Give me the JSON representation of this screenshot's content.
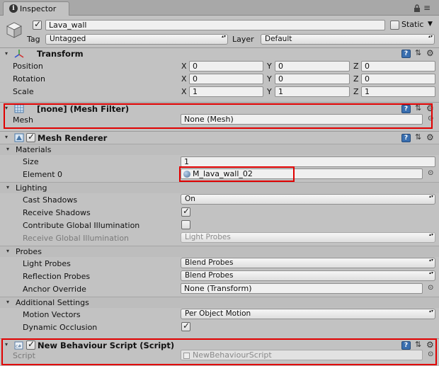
{
  "tab": {
    "label": "Inspector"
  },
  "header": {
    "name": "Lava_wall",
    "static_label": "Static",
    "tag_label": "Tag",
    "tag_value": "Untagged",
    "layer_label": "Layer",
    "layer_value": "Default"
  },
  "transform": {
    "title": "Transform",
    "rows": [
      {
        "label": "Position",
        "x": "0",
        "y": "0",
        "z": "0"
      },
      {
        "label": "Rotation",
        "x": "0",
        "y": "0",
        "z": "0"
      },
      {
        "label": "Scale",
        "x": "1",
        "y": "1",
        "z": "1"
      }
    ],
    "axis": {
      "x": "X",
      "y": "Y",
      "z": "Z"
    }
  },
  "mesh_filter": {
    "title": "[none] (Mesh Filter)",
    "mesh_label": "Mesh",
    "mesh_value": "None (Mesh)"
  },
  "mesh_renderer": {
    "title": "Mesh Renderer",
    "materials": {
      "label": "Materials",
      "size_label": "Size",
      "size_value": "1",
      "element_label": "Element 0",
      "element_value": "M_lava_wall_02"
    },
    "lighting": {
      "label": "Lighting",
      "cast_shadows_label": "Cast Shadows",
      "cast_shadows_value": "On",
      "receive_shadows_label": "Receive Shadows",
      "contribute_gi_label": "Contribute Global Illumination",
      "receive_gi_label": "Receive Global Illumination",
      "receive_gi_value": "Light Probes"
    },
    "probes": {
      "label": "Probes",
      "light_probes_label": "Light Probes",
      "light_probes_value": "Blend Probes",
      "reflection_probes_label": "Reflection Probes",
      "reflection_probes_value": "Blend Probes",
      "anchor_label": "Anchor Override",
      "anchor_value": "None (Transform)"
    },
    "additional": {
      "label": "Additional Settings",
      "motion_label": "Motion Vectors",
      "motion_value": "Per Object Motion",
      "occlusion_label": "Dynamic Occlusion"
    }
  },
  "script": {
    "title": "New Behaviour Script (Script)",
    "script_label": "Script",
    "script_value": "NewBehaviourScript"
  },
  "icons": {
    "collapsed_glyph": "▸",
    "expanded_glyph": "▾",
    "help": "?",
    "sliders": "⇅",
    "gear": "⚙",
    "target": "⊙",
    "lock": "🔒",
    "menu": "≡"
  }
}
